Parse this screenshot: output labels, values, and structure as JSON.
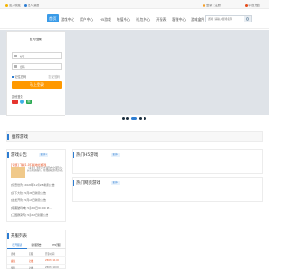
{
  "topbar": {
    "favorite": "加入收藏",
    "desktop": "放入桌面",
    "login": "登录 | 注册",
    "recharge": "平台充值"
  },
  "nav": {
    "items": [
      "首页",
      "游戏中心",
      "用户中心",
      "H5游戏",
      "充值中心",
      "礼包中心",
      "开服表",
      "客服中心",
      "游戏盒所"
    ],
    "active_index": 0
  },
  "search": {
    "placeholder": "游戏  请输入游戏名称"
  },
  "colors": {
    "brand": "#2d7dd2",
    "nav_active": "#3a9be8",
    "login_button": "#ff9900",
    "highlight": "#e64a19"
  },
  "login_box": {
    "title": "账号登录",
    "username_placeholder": "帐号",
    "password_placeholder": "密码",
    "remember": "记住密码",
    "forgot": "忘记密码",
    "submit": "马上登录",
    "other_login": "其他登录",
    "wechat": "微信"
  },
  "carousel": {
    "slides": 5,
    "active": 2
  },
  "recommend": {
    "title": "推荐游戏"
  },
  "notice": {
    "title": "游戏公告",
    "more": "更多>",
    "highlight": "[专题] 下载1.0下载地址游戏",
    "desc": "《魔龙》游戏正式版开启全服开户，完善资源福利，在线领取游戏活动。",
    "items": [
      "[传奇世界] 2023年12月28新服公告",
      "[霸下大陆] 5月28日新服公告",
      "[魔龙开局] 5月22日新服公告",
      "[暗黑破坏神] 5月20日10:00 17...",
      "[三国群英传] 5月22日新服公告"
    ]
  },
  "hot_h5": {
    "title": "热门H5游戏",
    "more": "更多>"
  },
  "hot_web": {
    "title": "热门网页游戏",
    "more": "更多>"
  },
  "servers": {
    "title": "开服列表",
    "tabs": [
      "已开服表",
      "新服预告",
      "H5开服"
    ],
    "rows": [
      [
        "游戏",
        "区服",
        "开服时间"
      ],
      [
        "魔龙",
        "双线",
        "25-03 11:00"
      ],
      [
        "传奇",
        "双线",
        "25-03 10:00"
      ]
    ]
  }
}
